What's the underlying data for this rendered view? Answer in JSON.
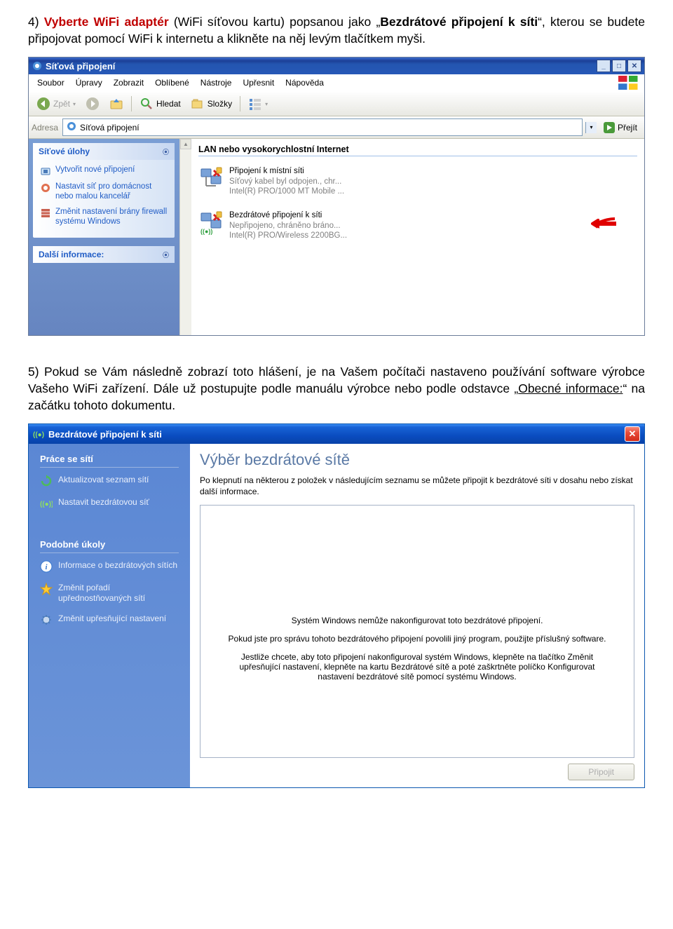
{
  "step4": {
    "num": "4)",
    "lead": "Vyberte WiFi adaptér",
    "paren": "(WiFi síťovou kartu) popsanou jako",
    "quote_open": "„",
    "highlight": "Bezdrátové připojení k síti",
    "quote_close": "“",
    "rest": ", kterou se budete připojovat pomocí WiFi k internetu a klikněte na něj levým tlačítkem myši."
  },
  "scr1": {
    "title": "Síťová připojení",
    "menus": [
      "Soubor",
      "Úpravy",
      "Zobrazit",
      "Oblíbené",
      "Nástroje",
      "Upřesnit",
      "Nápověda"
    ],
    "toolbar": {
      "back": "Zpět",
      "search": "Hledat",
      "folders": "Složky"
    },
    "addr": {
      "label": "Adresa",
      "value": "Síťová připojení",
      "go": "Přejít"
    },
    "panel1": {
      "title": "Síťové úlohy",
      "tasks": [
        "Vytvořit nové připojení",
        "Nastavit síť pro domácnost nebo malou kancelář",
        "Změnit nastavení brány firewall systému Windows"
      ]
    },
    "panel2": {
      "title": "Další informace:"
    },
    "group": "LAN nebo vysokorychlostní Internet",
    "conn1": {
      "l1": "Připojení k místní síti",
      "l2": "Síťový kabel byl odpojen., chr...",
      "l3": "Intel(R) PRO/1000 MT Mobile ..."
    },
    "conn2": {
      "l1": "Bezdrátové připojení k síti",
      "l2": "Nepřipojeno, chráněno bráno...",
      "l3": "Intel(R) PRO/Wireless 2200BG..."
    }
  },
  "step5": {
    "num": "5)",
    "text1": "Pokud se Vám následně zobrazí toto hlášení, je na Vašem počítači nastaveno používání software výrobce Vašeho WiFi zařízení. Dále už postupujte podle manuálu výrobce nebo podle odstavce „",
    "link": "Obecné informace:",
    "text2": "“ na začátku tohoto dokumentu."
  },
  "scr2": {
    "title": "Bezdrátové připojení k síti",
    "side": {
      "head1": "Práce se sítí",
      "t1": "Aktualizovat seznam sítí",
      "t2": "Nastavit bezdrátovou síť",
      "head2": "Podobné úkoly",
      "t3": "Informace o bezdrátových sítích",
      "t4": "Změnit pořadí upřednostňovaných sítí",
      "t5": "Změnit upřesňující nastavení"
    },
    "main": {
      "h": "Výběr bezdrátové sítě",
      "desc": "Po klepnutí na některou z položek v následujícím seznamu se můžete připojit k bezdrátové síti v dosahu nebo získat další informace.",
      "msg1": "Systém Windows nemůže nakonfigurovat toto bezdrátové připojení.",
      "msg2": "Pokud jste pro správu tohoto bezdrátového připojení povolili jiný program, použijte příslušný software.",
      "msg3": "Jestliže chcete, aby toto připojení nakonfiguroval systém Windows, klepněte na tlačítko Změnit upřesňující nastavení, klepněte na kartu Bezdrátové sítě a poté zaškrtněte políčko Konfigurovat nastavení bezdrátové sítě pomocí systému Windows.",
      "btn": "Připojit"
    }
  }
}
